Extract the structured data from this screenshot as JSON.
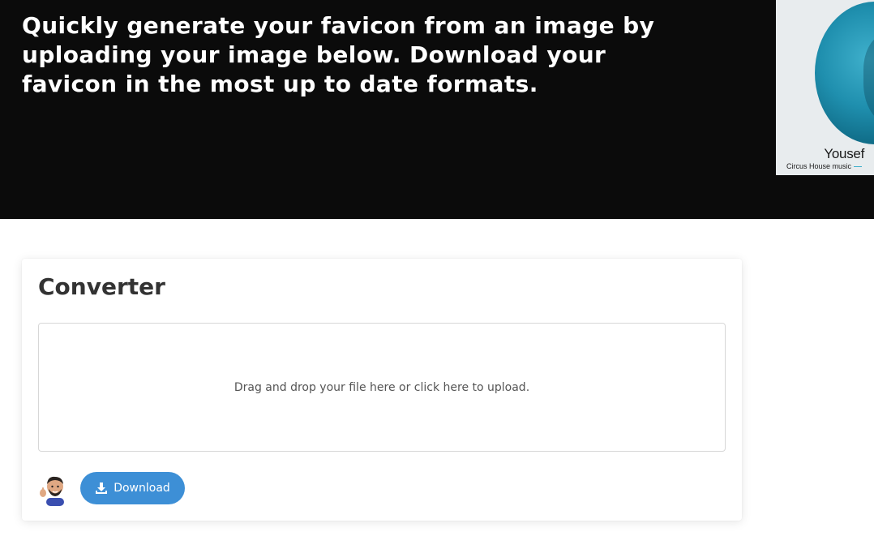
{
  "hero": {
    "headline": "Quickly generate your favicon from an image by uploading your image below. Download your favicon in the most up to date formats."
  },
  "ad": {
    "name": "Yousef",
    "subtitle": "Circus House music"
  },
  "converter": {
    "title": "Converter",
    "dropzone_text": "Drag and drop your file here or click here to upload.",
    "download_label": "Download"
  },
  "icons": {
    "download": "download-icon",
    "avatar": "memoji-avatar"
  },
  "colors": {
    "hero_background": "#0b0b0b",
    "button_background": "#3d8fd6",
    "ad_accent": "#1f8fae"
  }
}
